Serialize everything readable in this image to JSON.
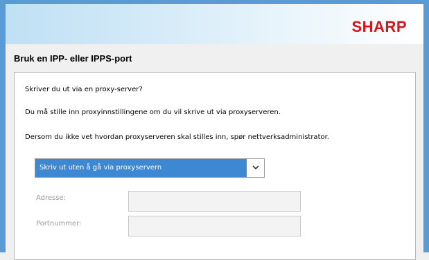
{
  "brand": {
    "logo_text": "SHARP",
    "logo_color": "#d7141a"
  },
  "section": {
    "title": "Bruk en IPP- eller IPPS-port"
  },
  "content": {
    "question": "Skriver du ut via en proxy-server?",
    "instruction": "Du må stille inn proxyinnstillingene om du vil skrive ut via proxyserveren.",
    "help": "Dersom du ikke vet hvordan proxyserveren skal stilles inn, spør nettverksadministrator."
  },
  "proxy_select": {
    "selected": "Skriv ut uten å gå via proxyservern",
    "icon": "chevron-down-icon"
  },
  "fields": {
    "address_label": "Adresse:",
    "address_value": "",
    "port_label": "Portnummer:",
    "port_value": ""
  },
  "colors": {
    "accent": "#3d87d3",
    "frame": "#5b9bd5"
  }
}
